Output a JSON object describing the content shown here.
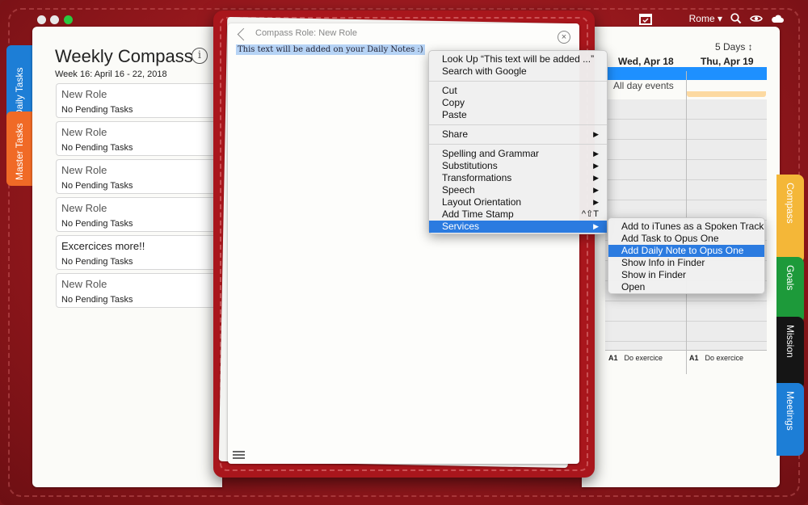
{
  "window": {
    "city": "Rome ▾"
  },
  "left_page": {
    "title": "Weekly Compass",
    "info": "i",
    "week": "Week 16: April 16 - 22, 2018",
    "roles": [
      {
        "name": "New Role",
        "status": "No Pending Tasks"
      },
      {
        "name": "New Role",
        "status": "No Pending Tasks"
      },
      {
        "name": "New Role",
        "status": "No Pending Tasks"
      },
      {
        "name": "New Role",
        "status": "No Pending Tasks"
      },
      {
        "name": "Excercices more!!",
        "status": "No Pending Tasks"
      },
      {
        "name": "New Role",
        "status": "No Pending Tasks"
      }
    ]
  },
  "left_tabs": {
    "daily": "Daily Tasks",
    "master": "Master Tasks"
  },
  "right_page": {
    "days": "5 Days ↕",
    "day1": "Wed, Apr 18",
    "day2": "Thu, Apr 19",
    "allday": "All day events",
    "activity1_code": "A1",
    "activity1_text": "Do exercice",
    "activity2_code": "A1",
    "activity2_text": "Do exercice"
  },
  "right_tabs": {
    "compass": "Compass",
    "goals": "Goals",
    "mission": "Mission",
    "meetings": "Meetings"
  },
  "note": {
    "title": "Compass Role: New Role",
    "close": "×",
    "text": "This text will be added on your Daily Notes :)"
  },
  "context_menu": {
    "lookup": "Look Up “This text will be added ...”",
    "search": "Search with Google",
    "cut": "Cut",
    "copy": "Copy",
    "paste": "Paste",
    "share": "Share",
    "spelling": "Spelling and Grammar",
    "substitutions": "Substitutions",
    "transformations": "Transformations",
    "speech": "Speech",
    "layout": "Layout Orientation",
    "timestamp": "Add Time Stamp",
    "timestamp_shortcut": "^⇧T",
    "services": "Services",
    "arrow": "▶"
  },
  "services_menu": {
    "itunes": "Add to iTunes as a Spoken Track",
    "add_task": "Add Task to Opus One",
    "add_note": "Add Daily Note to Opus One",
    "show_info": "Show Info in Finder",
    "show_finder": "Show in Finder",
    "open": "Open"
  }
}
